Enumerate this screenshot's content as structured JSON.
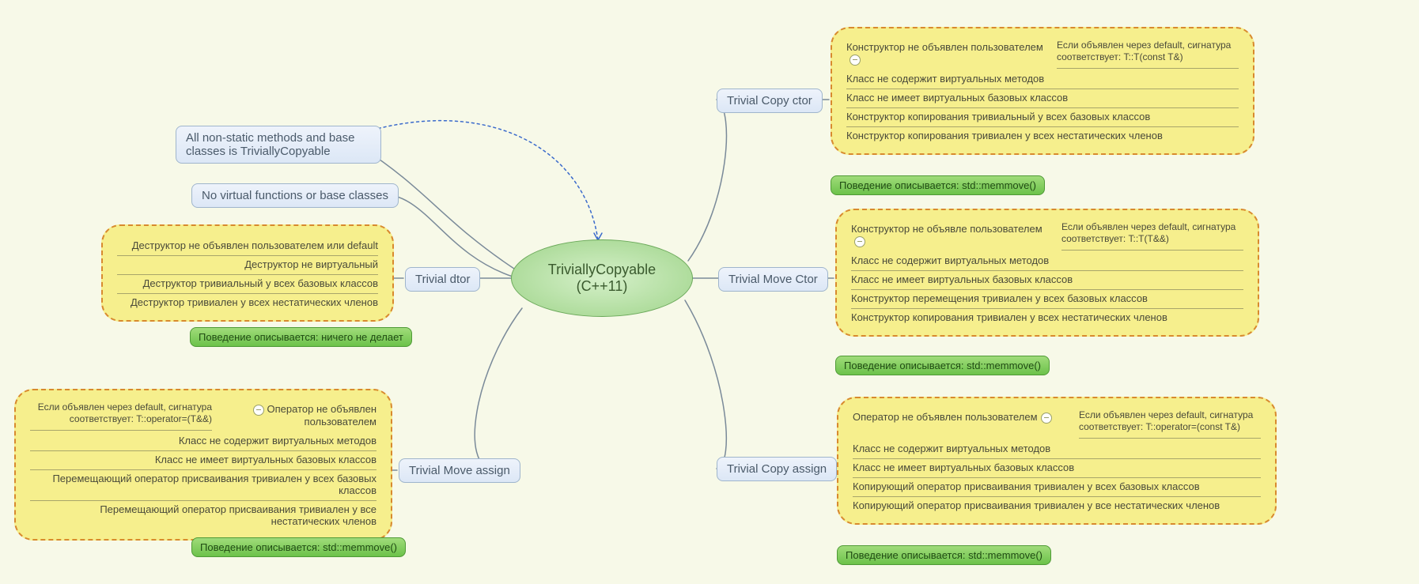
{
  "center": {
    "line1": "TriviallyCopyable",
    "line2": "(C++11)"
  },
  "branches": {
    "nonstatic": "All non-static methods and base classes is TriviallyCopyable",
    "novirtual": "No virtual functions or base classes",
    "dtor": "Trivial dtor",
    "moveassign": "Trivial Move assign",
    "copyctor": "Trivial Copy ctor",
    "movector": "Trivial Move Ctor",
    "copyassign": "Trivial Copy assign"
  },
  "clouds": {
    "dtor": {
      "rows": [
        "Деструктор не объявлен пользователем или default",
        "Деструктор не виртуальный",
        "Деструктор тривиальный у всех базовых классов",
        "Деструктор тривиален у всех нестатических членов"
      ],
      "behave": "Поведение описывается: ничего не делает"
    },
    "moveassign": {
      "first": "Оператор не объявлен пользователем",
      "sig": "Если объявлен через default, сигнатура соответствует: T::operator=(T&&)",
      "rows": [
        "Класс не содержит виртуальных методов",
        "Класс не имеет виртуальных базовых классов",
        "Перемещающий оператор присваивания тривиален у всех базовых классов",
        "Перемещающий оператор присваивания тривиален у все нестатических членов"
      ],
      "behave": "Поведение описывается: std::memmove()"
    },
    "copyctor": {
      "first": "Конструктор не объявлен пользователем",
      "sig": "Если объявлен через default, сигнатура соответствует: T::T(const T&)",
      "rows": [
        "Класс не содержит виртуальных методов",
        "Класс не имеет виртуальных базовых классов",
        "Конструктор копирования тривиальный у всех базовых классов",
        "Конструктор копирования тривиален у всех нестатических членов"
      ],
      "behave": "Поведение описывается: std::memmove()"
    },
    "movector": {
      "first": "Конструктор не объявле пользователем",
      "sig": "Если объявлен через default, сигнатура соответствует: T::T(T&&)",
      "rows": [
        "Класс не содержит виртуальных методов",
        "Класс не имеет виртуальных базовых классов",
        "Конструктор перемещения тривиален у всех базовых классов",
        "Конструктор копирования тривиален у всех нестатических членов"
      ],
      "behave": "Поведение описывается: std::memmove()"
    },
    "copyassign": {
      "first": "Оператор не объявлен пользователем",
      "sig": "Если объявлен через default, сигнатура соответствует: T::operator=(const T&)",
      "rows": [
        "Класс не содержит виртуальных методов",
        "Класс не имеет виртуальных базовых классов",
        "Копирующий оператор присваивания тривиален у всех базовых классов",
        "Копирующий оператор присваивания тривиален у все нестатических членов"
      ],
      "behave": "Поведение описывается: std::memmove()"
    }
  }
}
